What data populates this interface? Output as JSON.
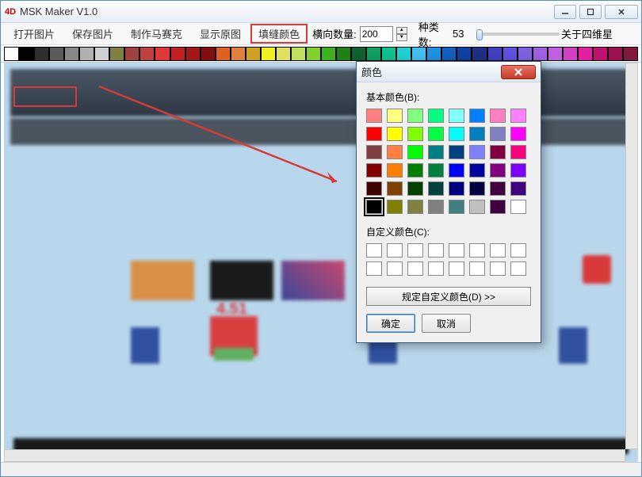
{
  "window": {
    "title": "MSK Maker V1.0",
    "icon_text": "4D"
  },
  "menu": {
    "open_image": "打开图片",
    "save_image": "保存图片",
    "make_mosaic": "制作马赛克",
    "show_original": "显示原图",
    "fill_seam_color": "填缝颜色",
    "horizontal_count": "横向数量:",
    "category_count": "种类数:",
    "about": "关于四维星"
  },
  "values": {
    "horizontal_count": "200",
    "category_count": "53"
  },
  "palette_bar": [
    "#ffffff",
    "#000000",
    "#2e2e2e",
    "#5a5a5a",
    "#888888",
    "#b0b0b0",
    "#d0d0d0",
    "#808040",
    "#a04040",
    "#c04040",
    "#e03838",
    "#c02020",
    "#a01818",
    "#801010",
    "#e06020",
    "#e08040",
    "#d0a020",
    "#f0f020",
    "#e0e060",
    "#c0e060",
    "#80d030",
    "#40b020",
    "#208018",
    "#106030",
    "#10a060",
    "#10c090",
    "#20d0d0",
    "#40c0f0",
    "#2090e0",
    "#1060c0",
    "#1040a0",
    "#203080",
    "#4040c0",
    "#6050e0",
    "#8060e0",
    "#a060e0",
    "#c060e0",
    "#d040c0",
    "#e020a0",
    "#c01070",
    "#a01050",
    "#801840"
  ],
  "color_dialog": {
    "title": "颜色",
    "basic_label": "基本颜色(B):",
    "custom_label": "自定义颜色(C):",
    "define_btn": "规定自定义颜色(D) >>",
    "ok": "确定",
    "cancel": "取消",
    "basic_colors": [
      "#ff8080",
      "#ffff80",
      "#80ff80",
      "#00ff80",
      "#80ffff",
      "#0080ff",
      "#ff80c0",
      "#ff80ff",
      "#ff0000",
      "#ffff00",
      "#80ff00",
      "#00ff40",
      "#00ffff",
      "#0080c0",
      "#8080c0",
      "#ff00ff",
      "#804040",
      "#ff8040",
      "#00ff00",
      "#008080",
      "#004080",
      "#8080ff",
      "#800040",
      "#ff0080",
      "#800000",
      "#ff8000",
      "#008000",
      "#008040",
      "#0000ff",
      "#0000a0",
      "#800080",
      "#8000ff",
      "#400000",
      "#804000",
      "#004000",
      "#004040",
      "#000080",
      "#000040",
      "#400040",
      "#400080",
      "#000000",
      "#808000",
      "#808040",
      "#808080",
      "#408080",
      "#c0c0c0",
      "#400040",
      "#ffffff"
    ],
    "selected_index": 40
  }
}
